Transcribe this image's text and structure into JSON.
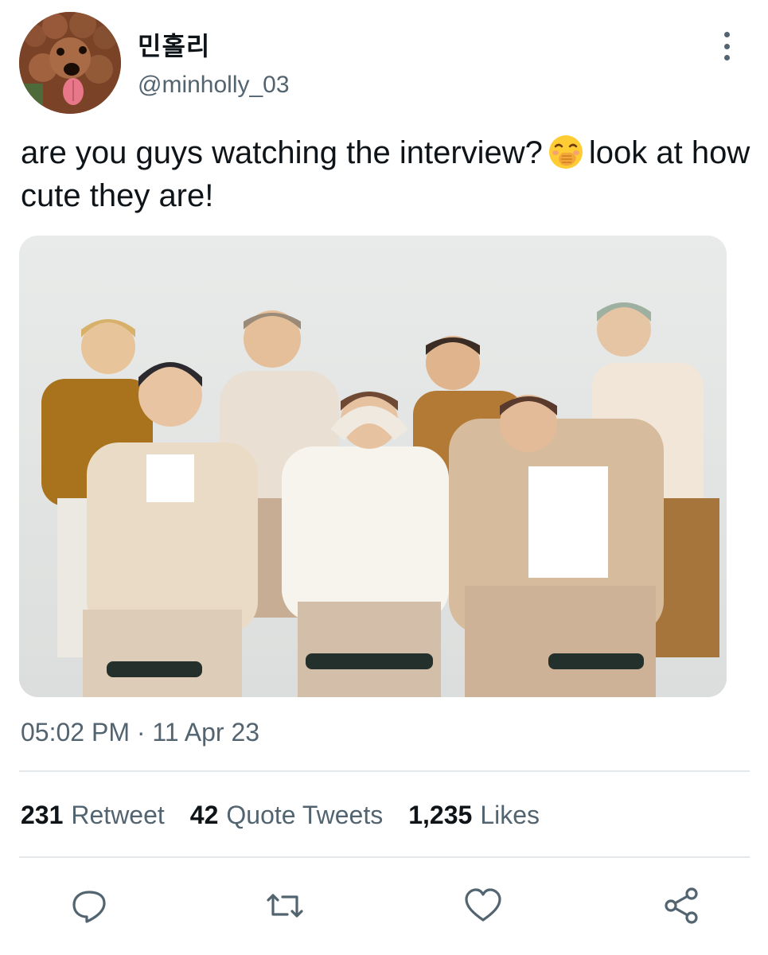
{
  "author": {
    "display_name": "민홀리",
    "handle": "@minholly_03",
    "avatar_icon": "dog-avatar"
  },
  "tweet": {
    "text_part1": "are you guys watching the interview?",
    "emoji_icon": "hand-over-mouth-emoji",
    "text_part2": "look at how cute they are!"
  },
  "media": {
    "description_icon": "group-photo"
  },
  "meta": {
    "timestamp": "05:02 PM · 11 Apr 23"
  },
  "stats": {
    "retweets_count": "231",
    "retweets_label": "Retweet",
    "quotes_count": "42",
    "quotes_label": "Quote Tweets",
    "likes_count": "1,235",
    "likes_label": "Likes"
  },
  "actions": [
    "reply-icon",
    "retweet-icon",
    "like-icon",
    "share-icon"
  ],
  "colors": {
    "primary_text": "#0f1419",
    "secondary_text": "#536471",
    "divider": "#e4e8eb"
  }
}
